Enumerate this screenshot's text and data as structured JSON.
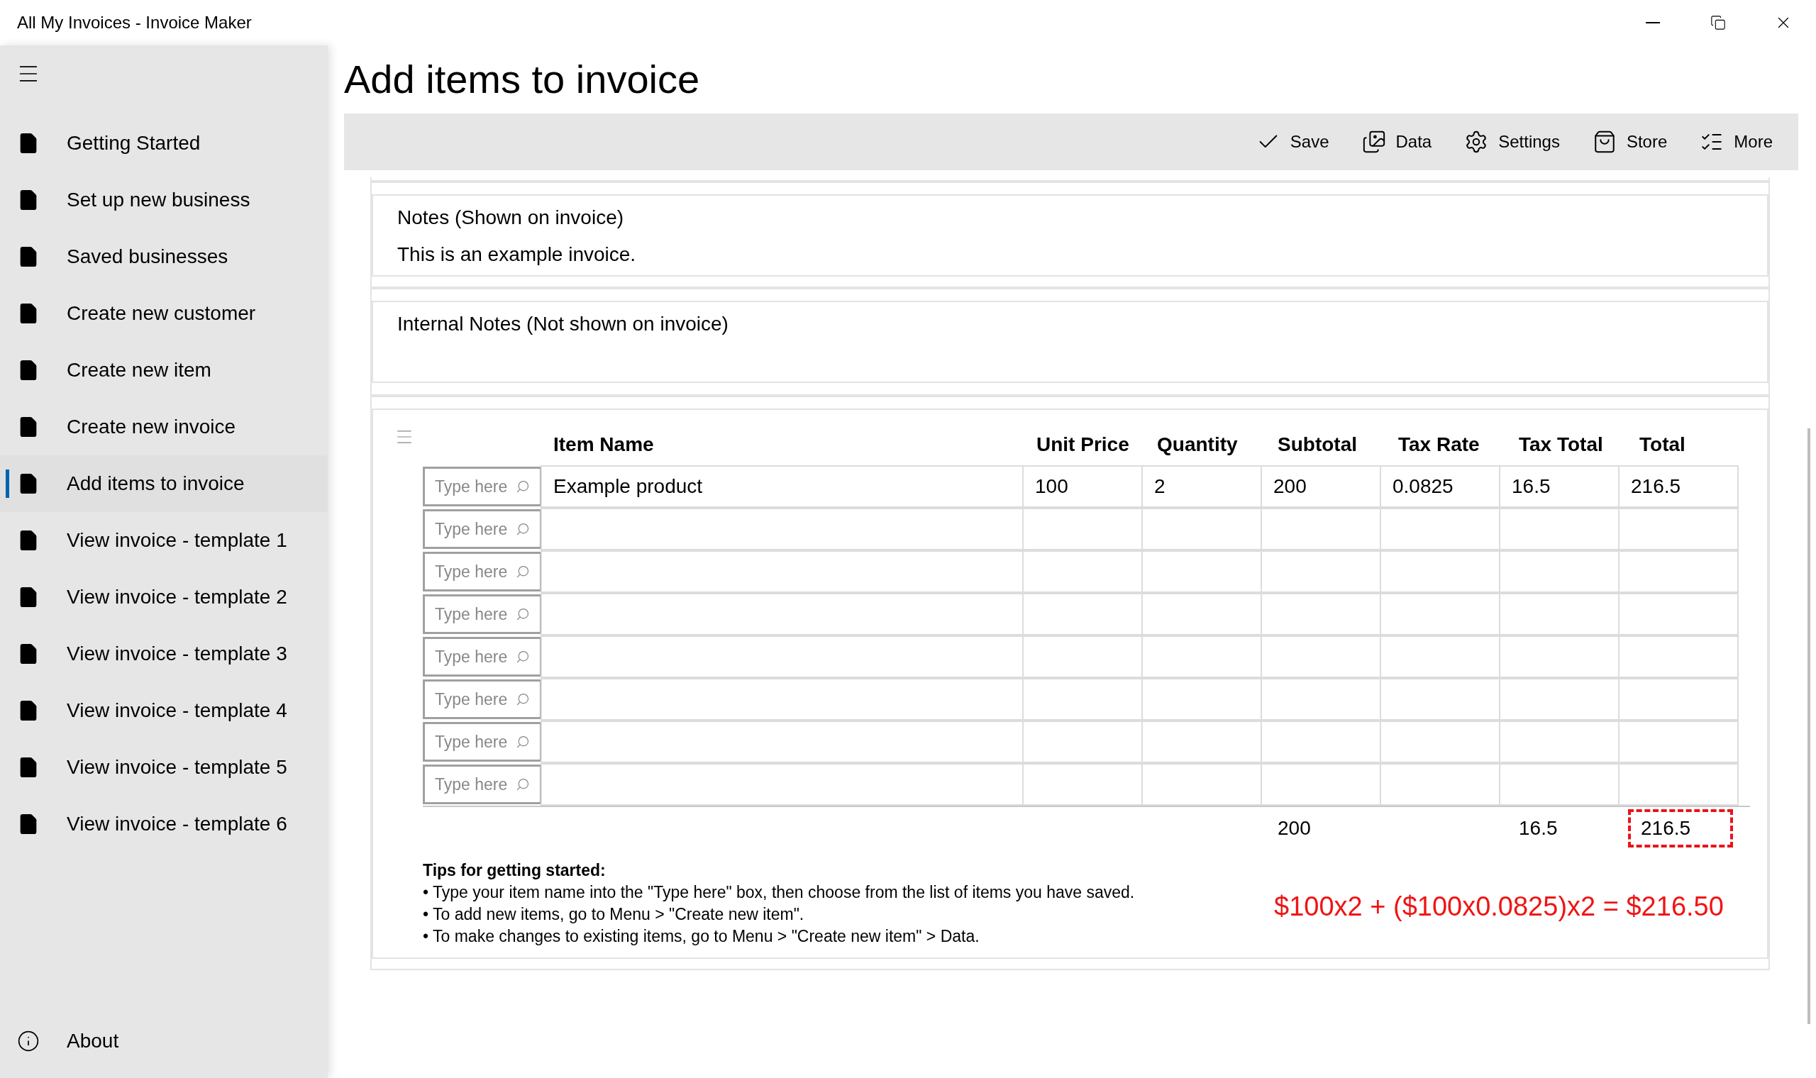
{
  "window": {
    "title": "All My Invoices - Invoice Maker"
  },
  "sidebar": {
    "items": [
      {
        "label": "Getting Started",
        "selected": false
      },
      {
        "label": "Set up new business",
        "selected": false
      },
      {
        "label": "Saved businesses",
        "selected": false
      },
      {
        "label": "Create new customer",
        "selected": false
      },
      {
        "label": "Create new item",
        "selected": false
      },
      {
        "label": "Create new invoice",
        "selected": false
      },
      {
        "label": "Add items to invoice",
        "selected": true
      },
      {
        "label": "View invoice - template 1",
        "selected": false
      },
      {
        "label": "View invoice - template 2",
        "selected": false
      },
      {
        "label": "View invoice - template 3",
        "selected": false
      },
      {
        "label": "View invoice - template 4",
        "selected": false
      },
      {
        "label": "View invoice - template 5",
        "selected": false
      },
      {
        "label": "View invoice - template 6",
        "selected": false
      }
    ],
    "footer_item": {
      "label": "About"
    }
  },
  "page_title": "Add items to invoice",
  "toolbar": [
    {
      "kind": "save",
      "label": "Save"
    },
    {
      "kind": "data",
      "label": "Data"
    },
    {
      "kind": "settings",
      "label": "Settings"
    },
    {
      "kind": "store",
      "label": "Store"
    },
    {
      "kind": "more",
      "label": "More"
    }
  ],
  "notes": {
    "label": "Notes (Shown on invoice)",
    "value": "This is an example invoice."
  },
  "internal_notes": {
    "label": "Internal Notes (Not shown on invoice)"
  },
  "table": {
    "columns": [
      "Item Name",
      "Unit Price",
      "Quantity",
      "Subtotal",
      "Tax Rate",
      "Tax Total",
      "Total"
    ],
    "rows": [
      {
        "placeholder": "Type here",
        "cells": [
          "Example product",
          "100",
          "2",
          "200",
          "0.0825",
          "16.5",
          "216.5"
        ]
      },
      {
        "placeholder": "Type here"
      },
      {
        "placeholder": "Type here"
      },
      {
        "placeholder": "Type here"
      },
      {
        "placeholder": "Type here"
      },
      {
        "placeholder": "Type here"
      },
      {
        "placeholder": "Type here"
      },
      {
        "placeholder": "Type here"
      }
    ],
    "totals": {
      "subtotal": "200",
      "tax_total": "16.5",
      "total": "216.5",
      "total_marked": true
    }
  },
  "tips": {
    "title": "Tips for getting started:",
    "lines": [
      "• Type your item name into the \"Type here\" box, then choose from the list of items you have saved.",
      "• To add new items, go to Menu > \"Create new item\".",
      "• To make changes to existing items, go to Menu > \"Create new item\" > Data."
    ]
  },
  "annotation": "$100x2 + ($100x0.0825)x2 = $216.50"
}
